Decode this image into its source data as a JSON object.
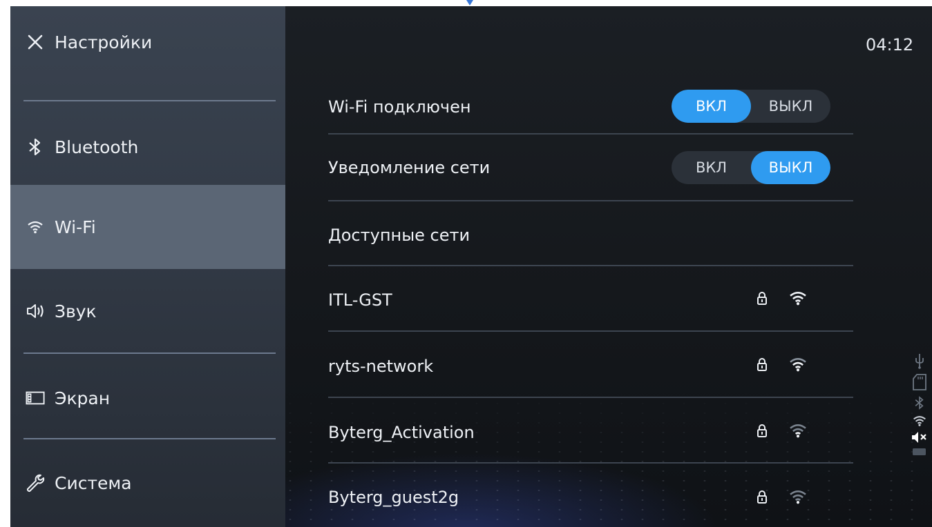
{
  "sidebar": {
    "title": "Настройки",
    "items": [
      {
        "label": "Bluetooth",
        "icon": "bluetooth-icon"
      },
      {
        "label": "Wi-Fi",
        "icon": "wifi-icon",
        "active": true
      },
      {
        "label": "Звук",
        "icon": "speaker-icon"
      },
      {
        "label": "Экран",
        "icon": "screen-icon"
      },
      {
        "label": "Система",
        "icon": "wrench-icon"
      }
    ]
  },
  "status": {
    "time": "04:12"
  },
  "wifi": {
    "connected_label": "Wi-Fi подключен",
    "connected_on": "ВКЛ",
    "connected_off": "ВЫКЛ",
    "connected_state": "on",
    "notify_label": "Уведомление сети",
    "notify_on": "ВКЛ",
    "notify_off": "ВЫКЛ",
    "notify_state": "off",
    "available_label": "Доступные сети",
    "networks": [
      {
        "ssid": "ITL-GST",
        "locked": true
      },
      {
        "ssid": "ryts-network",
        "locked": true
      },
      {
        "ssid": "Byterg_Activation",
        "locked": true
      },
      {
        "ssid": "Byterg_guest2g",
        "locked": true
      }
    ]
  },
  "colors": {
    "accent": "#2f9bf0",
    "sidebar_active": "#5b6675"
  }
}
